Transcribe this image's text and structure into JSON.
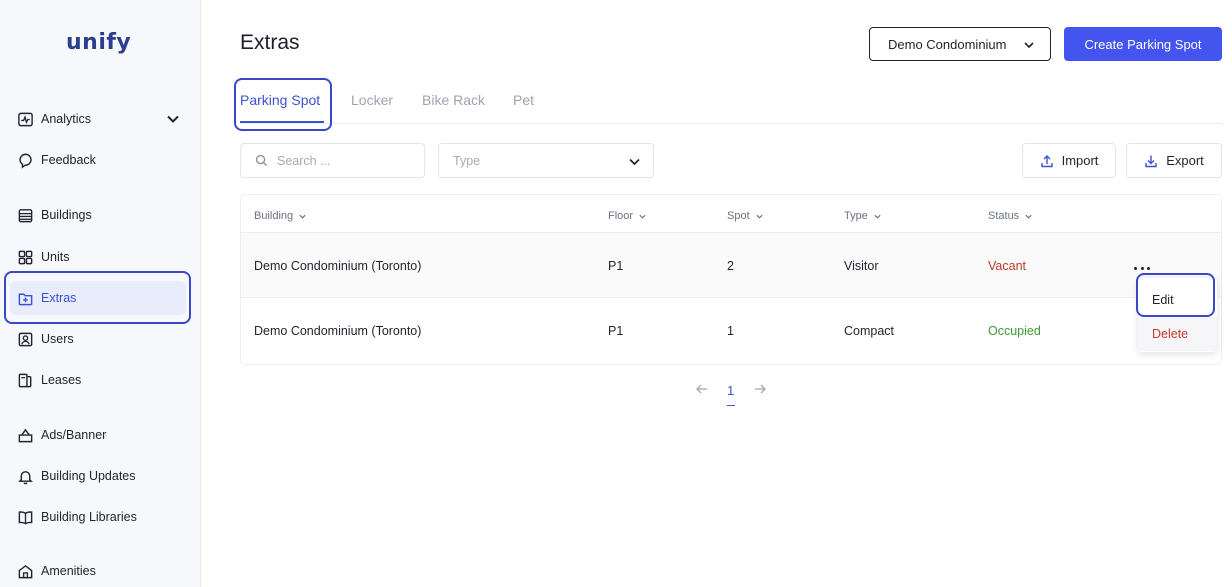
{
  "brand": {
    "logo": "unify"
  },
  "sidebar": {
    "items": [
      {
        "label": "Analytics",
        "icon": "analytics-icon"
      },
      {
        "label": "Feedback",
        "icon": "feedback-icon"
      },
      {
        "label": "Buildings",
        "icon": "buildings-icon"
      },
      {
        "label": "Units",
        "icon": "units-icon"
      },
      {
        "label": "Extras",
        "icon": "extras-icon",
        "active": true
      },
      {
        "label": "Users",
        "icon": "users-icon"
      },
      {
        "label": "Leases",
        "icon": "leases-icon"
      },
      {
        "label": "Ads/Banner",
        "icon": "ads-banner-icon"
      },
      {
        "label": "Building Updates",
        "icon": "bell-icon"
      },
      {
        "label": "Building Libraries",
        "icon": "book-icon"
      },
      {
        "label": "Amenities",
        "icon": "amenities-icon"
      }
    ]
  },
  "header": {
    "title": "Extras",
    "building_select": "Demo Condominium",
    "create_label": "Create Parking Spot"
  },
  "tabs": [
    {
      "label": "Parking Spot",
      "active": true
    },
    {
      "label": "Locker"
    },
    {
      "label": "Bike Rack"
    },
    {
      "label": "Pet"
    }
  ],
  "filters": {
    "search_placeholder": "Search ...",
    "type_placeholder": "Type",
    "import_label": "Import",
    "export_label": "Export"
  },
  "table": {
    "columns": [
      "Building",
      "Floor",
      "Spot",
      "Type",
      "Status"
    ],
    "rows": [
      {
        "building": "Demo Condominium (Toronto)",
        "floor": "P1",
        "spot": "2",
        "type": "Visitor",
        "status": "Vacant"
      },
      {
        "building": "Demo Condominium (Toronto)",
        "floor": "P1",
        "spot": "1",
        "type": "Compact",
        "status": "Occupied"
      }
    ]
  },
  "row_menu": {
    "edit": "Edit",
    "delete": "Delete"
  },
  "pagination": {
    "current": "1"
  },
  "colors": {
    "accent": "#3b52d4",
    "primary_button": "#4454ee",
    "vacant": "#c0392b",
    "occupied": "#3f9a3a"
  }
}
